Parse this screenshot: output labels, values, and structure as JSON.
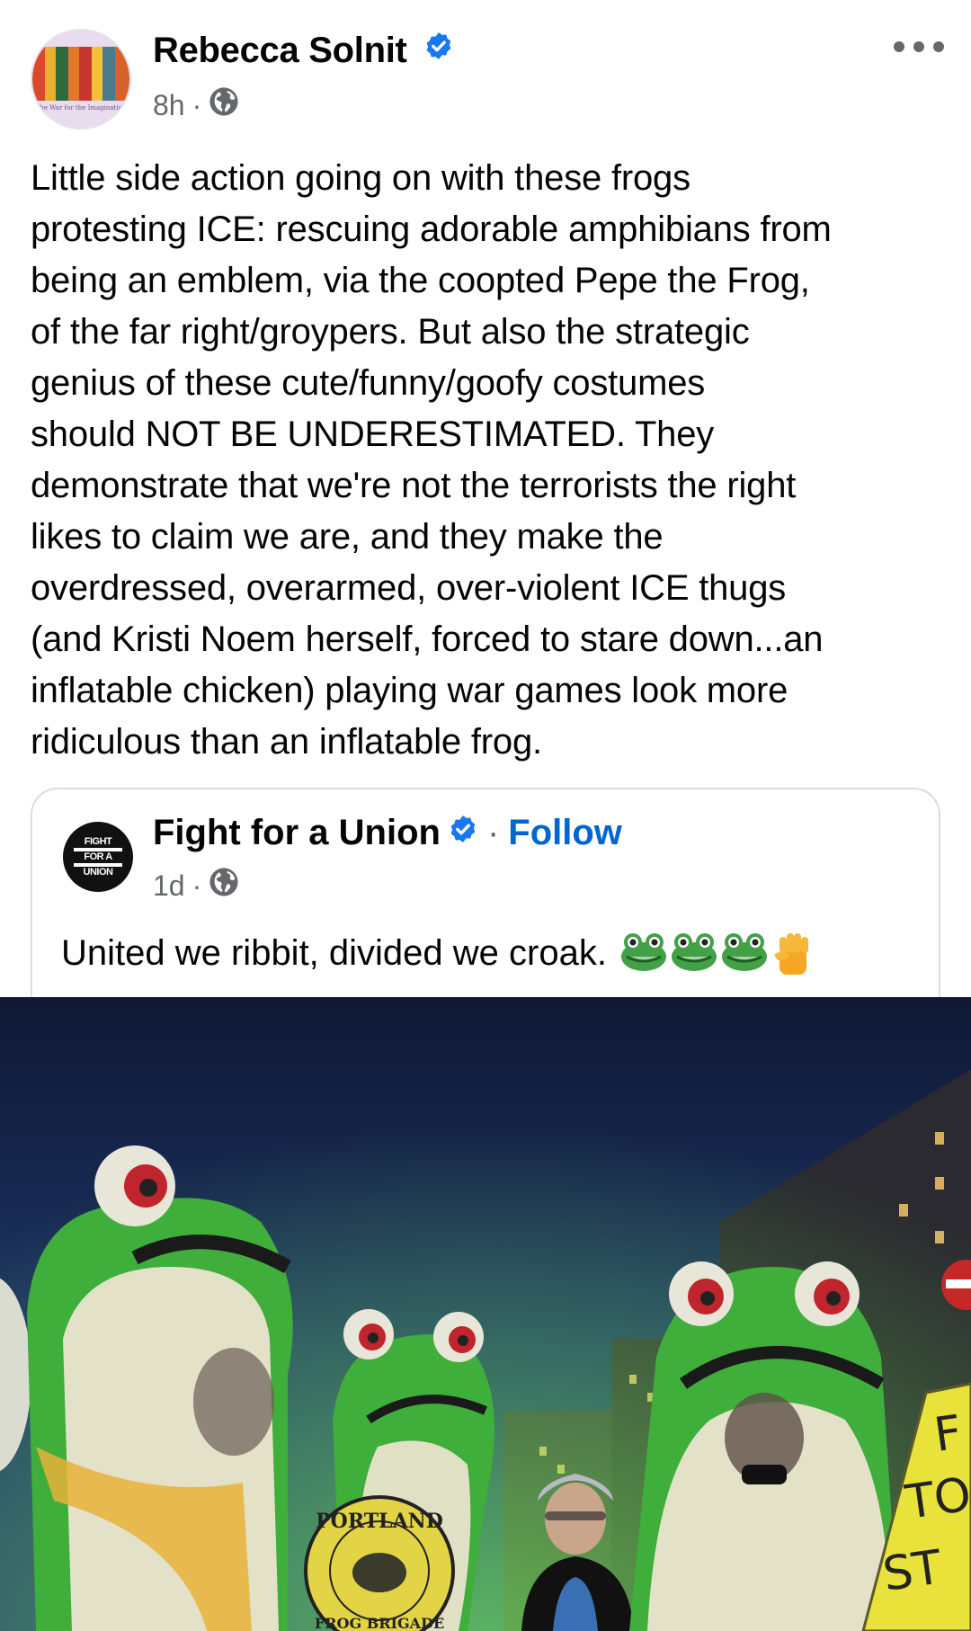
{
  "post": {
    "author": "Rebecca Solnit",
    "time": "8h",
    "separator": "·",
    "avatar_caption": "The War for the Imagination",
    "text_lines": [
      "Little side action going on with these frogs",
      "protesting ICE: rescuing adorable amphibians from",
      "being an emblem, via the coopted Pepe the Frog,",
      "of the far right/groypers. But also the strategic",
      "genius of these cute/funny/goofy costumes",
      "should NOT BE UNDERESTIMATED. They",
      "demonstrate that we're not the terrorists the right",
      "likes to claim we are, and they make the",
      "overdressed, overarmed, over-violent ICE thugs",
      "(and Kristi Noem herself, forced to stare down...an",
      "inflatable chicken) playing war games look more",
      "ridiculous than an inflatable frog."
    ]
  },
  "shared": {
    "author": "Fight for a Union",
    "follow_sep": "·",
    "follow": "Follow",
    "time": "1d",
    "separator": "·",
    "text": "United we ribbit, divided we croak.",
    "logo_lines": [
      "FIGHT",
      "FOR A",
      "UNION"
    ]
  },
  "photo": {
    "badge_top": "PORTLAND",
    "badge_bottom": "FROG BRIGADE",
    "sign_text": "F TO ST"
  },
  "colors": {
    "accent": "#0064d1",
    "verified": "#1877f2",
    "secondary_text": "#65676b",
    "frog_green": "#3fae3b"
  },
  "icons": {
    "verified": "verified-badge-icon",
    "globe": "globe-icon",
    "more": "more-options-icon",
    "frog_emoji": "frog-face-emoji",
    "fist_emoji": "raised-fist-emoji"
  }
}
